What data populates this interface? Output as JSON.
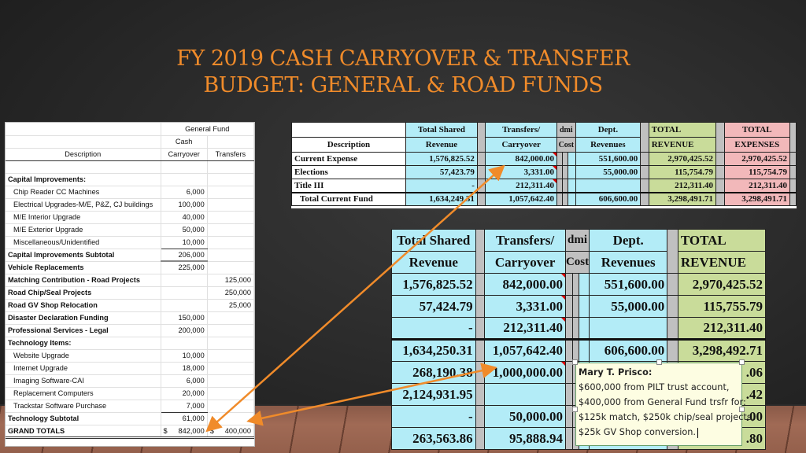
{
  "slide": {
    "title_line1": "FY 2019 CASH CARRYOVER & TRANSFER",
    "title_line2": "BUDGET: GENERAL & ROAD FUNDS",
    "accent_color": "#f08b2a"
  },
  "general_fund_table": {
    "group_header": "General Fund",
    "col_header_cash": "Cash",
    "col_header_carryover": "Carryover",
    "col_header_description": "Description",
    "col_header_transfers": "Transfers",
    "rows": [
      {
        "label": "Capital Improvements:",
        "carryover": "",
        "transfers": "",
        "style": "bold"
      },
      {
        "label": "Chip Reader CC Machines",
        "carryover": "6,000",
        "transfers": "",
        "style": "indent"
      },
      {
        "label": "Electrical Upgrades-M/E, P&Z, CJ buildings",
        "carryover": "100,000",
        "transfers": "",
        "style": "indent"
      },
      {
        "label": "M/E Interior Upgrade",
        "carryover": "40,000",
        "transfers": "",
        "style": "indent"
      },
      {
        "label": "M/E Exterior Upgrade",
        "carryover": "50,000",
        "transfers": "",
        "style": "indent"
      },
      {
        "label": "Miscellaneous/Unidentified",
        "carryover": "10,000",
        "transfers": "",
        "style": "indent"
      },
      {
        "label": "Capital Improvements Subtotal",
        "carryover": "206,000",
        "transfers": "",
        "style": "bold"
      },
      {
        "label": "Vehicle Replacements",
        "carryover": "225,000",
        "transfers": "",
        "style": "bold"
      },
      {
        "label": "Matching Contribution - Road Projects",
        "carryover": "",
        "transfers": "125,000",
        "style": "bold"
      },
      {
        "label": "Road Chip/Seal Projects",
        "carryover": "",
        "transfers": "250,000",
        "style": "bold"
      },
      {
        "label": "Road GV Shop Relocation",
        "carryover": "",
        "transfers": "25,000",
        "style": "bold"
      },
      {
        "label": "Disaster Declaration Funding",
        "carryover": "150,000",
        "transfers": "",
        "style": "bold"
      },
      {
        "label": "Professional Services - Legal",
        "carryover": "200,000",
        "transfers": "",
        "style": "bold"
      },
      {
        "label": "Technology Items:",
        "carryover": "",
        "transfers": "",
        "style": "bold"
      },
      {
        "label": "Website Upgrade",
        "carryover": "10,000",
        "transfers": "",
        "style": "indent"
      },
      {
        "label": "Internet Upgrade",
        "carryover": "18,000",
        "transfers": "",
        "style": "indent"
      },
      {
        "label": "Imaging Software-CAI",
        "carryover": "6,000",
        "transfers": "",
        "style": "indent"
      },
      {
        "label": "Replacement Computers",
        "carryover": "20,000",
        "transfers": "",
        "style": "indent"
      },
      {
        "label": "Trackstar Software Purchase",
        "carryover": "7,000",
        "transfers": "",
        "style": "indent"
      },
      {
        "label": "Technology Subtotal",
        "carryover": "61,000",
        "transfers": "",
        "style": "bold"
      }
    ],
    "grand_totals": {
      "label": "GRAND TOTALS",
      "currency": "$",
      "carryover": "842,000",
      "transfers": "400,000"
    }
  },
  "top_budget_table": {
    "headers": {
      "description": "Description",
      "shared_1": "Total Shared",
      "shared_2": "Revenue",
      "transfers_1": "Transfers/",
      "transfers_2": "Carryover",
      "admin_1": "dmi",
      "admin_2": "Cost",
      "dept_1": "Dept.",
      "dept_2": "Revenues",
      "total_rev_1": "TOTAL",
      "total_rev_2": "REVENUE",
      "total_exp_1": "TOTAL",
      "total_exp_2": "EXPENSES"
    },
    "rows": [
      {
        "label": "Current Expense",
        "shared": "1,576,825.52",
        "transfers": "842,000.00",
        "dept": "551,600.00",
        "total_rev": "2,970,425.52",
        "total_exp": "2,970,425.52"
      },
      {
        "label": "Elections",
        "shared": "57,423.79",
        "transfers": "3,331.00",
        "dept": "55,000.00",
        "total_rev": "115,754.79",
        "total_exp": "115,754.79"
      },
      {
        "label": "Title III",
        "shared": "-",
        "transfers": "212,311.40",
        "dept": "",
        "total_rev": "212,311.40",
        "total_exp": "212,311.40"
      },
      {
        "label": "Total Current Fund",
        "shared": "1,634,249.31",
        "transfers": "1,057,642.40",
        "dept": "606,600.00",
        "total_rev": "3,298,491.71",
        "total_exp": "3,298,491.71"
      }
    ]
  },
  "bottom_budget_table": {
    "headers": {
      "shared_1": "Total Shared",
      "shared_2": "Revenue",
      "transfers_1": "Transfers/",
      "transfers_2": "Carryover",
      "admin_1": "dmi",
      "admin_2": "Cost",
      "dept_1": "Dept.",
      "dept_2": "Revenues",
      "total_rev_1": "TOTAL",
      "total_rev_2": "REVENUE"
    },
    "rows": [
      {
        "shared": "1,576,825.52",
        "transfers": "842,000.00",
        "dept": "551,600.00",
        "total_rev": "2,970,425.52"
      },
      {
        "shared": "57,424.79",
        "transfers": "3,331.00",
        "dept": "55,000.00",
        "total_rev": "115,755.79"
      },
      {
        "shared": "-",
        "transfers": "212,311.40",
        "dept": "",
        "total_rev": "212,311.40"
      },
      {
        "shared": "1,634,250.31",
        "transfers": "1,057,642.40",
        "dept": "606,600.00",
        "total_rev": "3,298,492.71"
      },
      {
        "shared": "268,190.38",
        "transfers": "1,000,000.00",
        "dept": "",
        "total_rev": ".06"
      },
      {
        "shared": "2,124,931.95",
        "transfers": "",
        "dept": "",
        "total_rev": ".42"
      },
      {
        "shared": "-",
        "transfers": "50,000.00",
        "dept": "",
        "total_rev": ".00"
      },
      {
        "shared": "263,563.86",
        "transfers": "95,888.94",
        "dept": "",
        "total_rev": ".80"
      }
    ]
  },
  "comment": {
    "author": "Mary T. Prisco:",
    "lines": [
      "$600,000 from PILT trust account,",
      "$400,000 from General Fund trsfr for:",
      "$125k match, $250k chip/seal projects,",
      "$25k GV Shop conversion."
    ]
  }
}
